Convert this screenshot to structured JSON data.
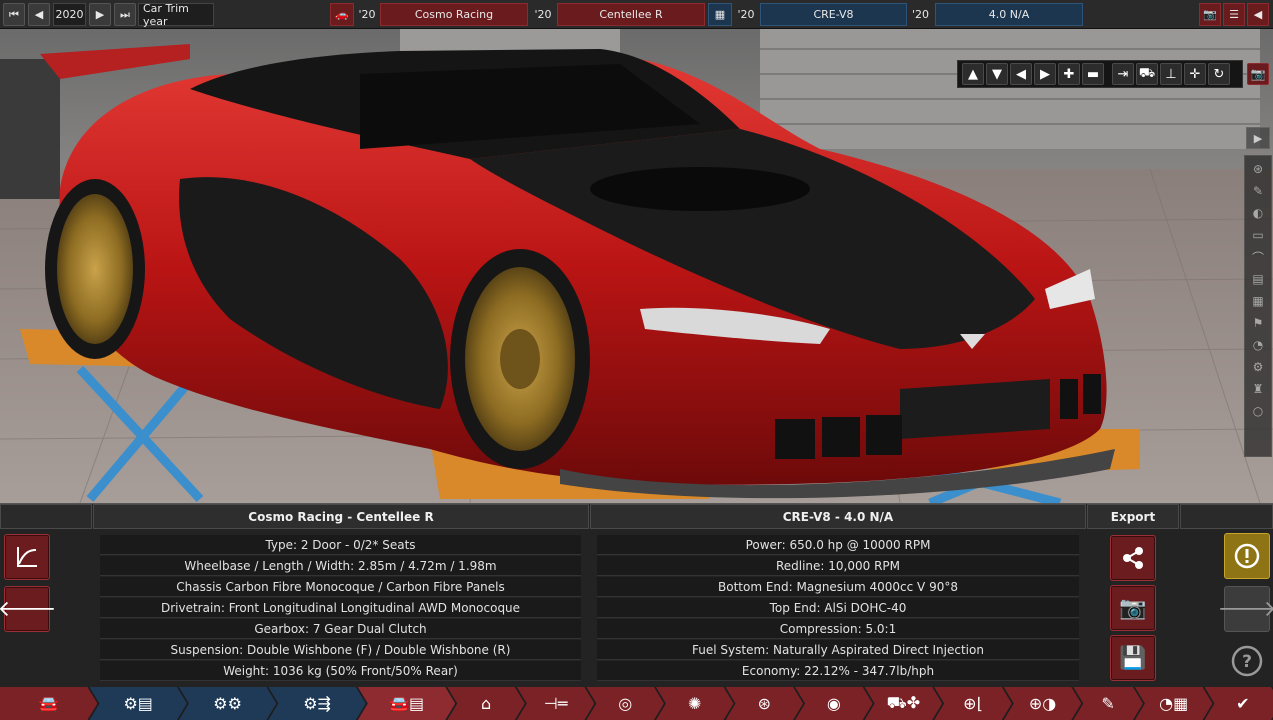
{
  "topbar": {
    "trim_year": "2020",
    "trim_year_label": "Car Trim year",
    "model_year": "'20",
    "model_name": "Cosmo Racing",
    "trim_year_short": "'20",
    "trim_name": "Centellee R",
    "engine_family_year": "'20",
    "engine_family": "CRE-V8",
    "variant_year": "'20",
    "variant_name": "4.0 N/A",
    "icons": [
      "rewind-icon",
      "prev-icon",
      "next-icon",
      "fast-forward-icon",
      "car-body-icon",
      "engine-icon",
      "camera-icon",
      "list-icon",
      "back-icon"
    ]
  },
  "camera_tools": [
    "arrow-up-icon",
    "arrow-down-icon",
    "arrow-left-icon",
    "arrow-right-icon",
    "zoom-in-icon",
    "zoom-out-icon",
    "align-right-icon",
    "car-view-icon",
    "floor-icon",
    "center-icon",
    "reset-rotation-icon",
    "screenshot-icon"
  ],
  "side_palette": [
    "play-icon",
    "wheel-icon",
    "paint-icon",
    "lights-icon",
    "trim-icon",
    "intake-icon",
    "vents-icon",
    "grille-icon",
    "badge-icon",
    "gauge-icon",
    "gear-icon",
    "person-icon",
    "circle-icon"
  ],
  "car_panel": {
    "title": "Cosmo Racing - Centellee R",
    "rows": [
      "Type: 2 Door - 0/2* Seats",
      "Wheelbase / Length / Width: 2.85m / 4.72m / 1.98m",
      "Chassis Carbon Fibre Monocoque / Carbon Fibre Panels",
      "Drivetrain: Front Longitudinal Longitudinal AWD Monocoque",
      "Gearbox: 7 Gear Dual Clutch",
      "Suspension: Double Wishbone (F) / Double Wishbone (R)",
      "Weight: 1036 kg (50% Front/50% Rear)"
    ]
  },
  "engine_panel": {
    "title": "CRE-V8 - 4.0 N/A",
    "rows": [
      "Power: 650.0 hp @ 10000 RPM",
      "Redline:  10,000 RPM",
      "Bottom End: Magnesium 4000cc V 90°8",
      "Top End: AlSi DOHC-40",
      "Compression: 5.0:1",
      "Fuel System: Naturally Aspirated Direct Injection",
      "Economy: 22.12% - 347.7lb/hph"
    ]
  },
  "export": {
    "title": "Export",
    "buttons": [
      "share-icon",
      "camera-icon",
      "save-icon"
    ]
  },
  "right_actions": [
    "warning-icon",
    "arrow-right-icon",
    "help-icon"
  ],
  "left_actions": [
    "graph-icon",
    "back-arrow-icon"
  ],
  "nav_tabs": [
    "car-icon",
    "engine-parts-icon",
    "engine-block-icon",
    "engine-tune-icon",
    "car-stats-icon",
    "chassis-icon",
    "drivetrain-icon",
    "headlight-icon",
    "gear-sprocket-icon",
    "wheel-icon",
    "brake-disc-icon",
    "car-fan-icon",
    "steering-seat-icon",
    "steering-ball-icon",
    "paint-icon",
    "gauge-flag-icon",
    "check-icon"
  ],
  "colors": {
    "accent_red": "#7a2226",
    "accent_blue": "#1f3a57",
    "warning_yellow": "#8f7416",
    "car_paint": "#c81c1c",
    "car_wheels": "#a8832c",
    "lift_orange": "#d68a2a",
    "lift_blue": "#3a8ec9"
  }
}
